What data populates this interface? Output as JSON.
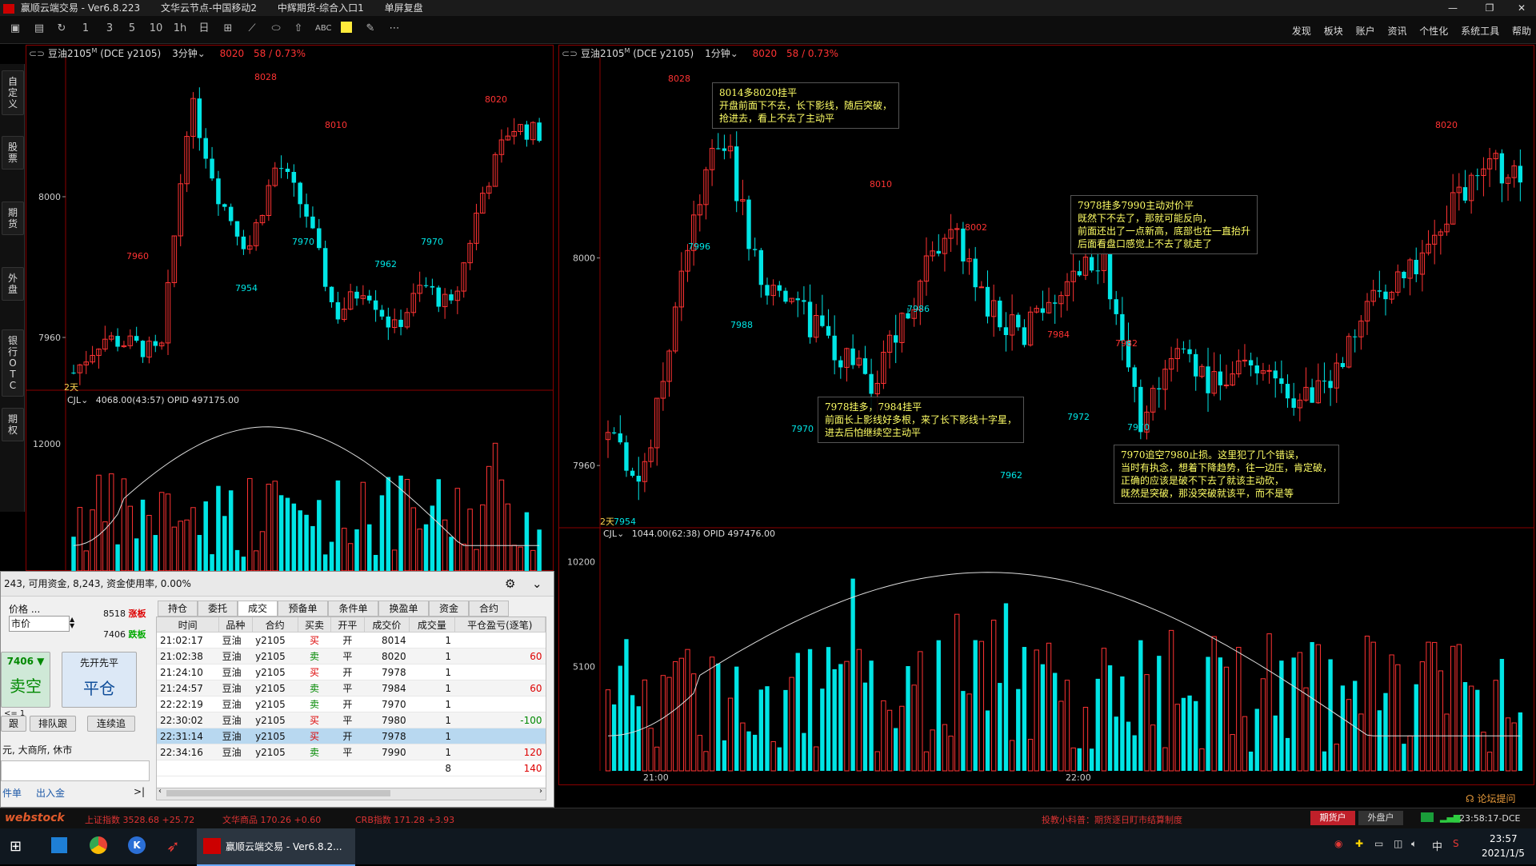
{
  "window": {
    "app_title": "赢顺云端交易 - Ver6.8.223",
    "connection1": "文华云节点-中国移动2",
    "connection2": "中辉期货-综合入口1",
    "mode": "单屏复盘"
  },
  "menu": [
    "发现",
    "板块",
    "账户",
    "资讯",
    "个性化",
    "系统工具",
    "帮助"
  ],
  "sidenav": [
    "自定义",
    "股票",
    "期货",
    "外盘",
    "银行OTC",
    "期权"
  ],
  "left_chart": {
    "symbol": "豆油2105",
    "symbol_sup": "M",
    "exchange": "(DCE y2105)",
    "period": "3分钟",
    "price": "8020",
    "change": "58 / 0.73%",
    "indicator_label": "CJL",
    "indicator_values": "4068.00(43:57)  OPID 497175.00",
    "days_marker": "2天"
  },
  "right_chart": {
    "symbol": "豆油2105",
    "symbol_sup": "M",
    "exchange": "(DCE y2105)",
    "period": "1分钟",
    "price": "8020",
    "change": "58 / 0.73%",
    "indicator_label": "CJL",
    "indicator_values": "1044.00(62:38)  OPID 497476.00",
    "days_marker": "2天",
    "time_labels": [
      "21:00",
      "22:00"
    ],
    "annotations": [
      "8014多8020挂平\n开盘前面下不去，长下影线，随后突破，\n抢进去，看上不去了主动平",
      "7978挂多7990主动对价平\n既然下不去了，那就可能反向，\n前面还出了一点新高，底部也在一直抬升\n后面看盘口感觉上不去了就走了",
      "7978挂多，7984挂平\n前面长上影线好多根，来了长下影线十字星，\n进去后怕继续空主动平",
      "7970追空7980止损。这里犯了几个错误，\n当时有执念，想着下降趋势，往一边压，肯定破，\n正确的应该是破不下去了就该主动砍，\n既然是突破，那没突破就该平，而不是等"
    ]
  },
  "chart_data": [
    {
      "type": "candlestick",
      "title": "豆油2105 3分钟",
      "y_ticks": [
        7960,
        8000
      ],
      "volume_ticks": [
        12000
      ],
      "price_labels": [
        "8028",
        "8010",
        "8020",
        "7960",
        "7954",
        "7970",
        "7962",
        "7970"
      ]
    },
    {
      "type": "candlestick",
      "title": "豆油2105 1分钟",
      "y_ticks": [
        7960,
        8000
      ],
      "volume_ticks": [
        5100,
        10200
      ],
      "x_ticks": [
        "21:00",
        "22:00"
      ],
      "price_labels": [
        "8028",
        "7996",
        "7988",
        "7970",
        "8010",
        "7986",
        "8002",
        "7962",
        "7984",
        "7972",
        "7982",
        "7970",
        "8020",
        "7954"
      ]
    }
  ],
  "trade_panel": {
    "header": "243, 可用资金, 8,243, 资金使用率, 0.00%",
    "price_label": "价格 ...",
    "price_value": "市价",
    "limit_up_value": "8518",
    "limit_up_label": "涨板",
    "limit_down_value": "7406",
    "limit_down_label": "跌板",
    "qty_price": "7406",
    "sell_button": "卖空",
    "flat_label": "先开先平",
    "flat_button": "平仓",
    "qty_hint": "<= 1",
    "follow1": "跟",
    "follow2": "排队跟",
    "follow3": "连续追",
    "exchange_status": "元, 大商所, 休市",
    "link1": "件单",
    "link2": "出入金",
    "tabs": [
      "持仓",
      "委托",
      "成交",
      "预备单",
      "条件单",
      "换盈单",
      "资金",
      "合约"
    ],
    "active_tab": "成交",
    "columns": [
      "时间",
      "品种",
      "合约",
      "买卖",
      "开平",
      "成交价",
      "成交量",
      "平仓盈亏(逐笔)"
    ],
    "rows": [
      {
        "time": "21:02:17",
        "name": "豆油",
        "contract": "y2105",
        "side": "买",
        "oc": "开",
        "price": "8014",
        "qty": "1",
        "pnl": ""
      },
      {
        "time": "21:02:38",
        "name": "豆油",
        "contract": "y2105",
        "side": "卖",
        "oc": "平",
        "price": "8020",
        "qty": "1",
        "pnl": "60"
      },
      {
        "time": "21:24:10",
        "name": "豆油",
        "contract": "y2105",
        "side": "买",
        "oc": "开",
        "price": "7978",
        "qty": "1",
        "pnl": ""
      },
      {
        "time": "21:24:57",
        "name": "豆油",
        "contract": "y2105",
        "side": "卖",
        "oc": "平",
        "price": "7984",
        "qty": "1",
        "pnl": "60"
      },
      {
        "time": "22:22:19",
        "name": "豆油",
        "contract": "y2105",
        "side": "卖",
        "oc": "开",
        "price": "7970",
        "qty": "1",
        "pnl": ""
      },
      {
        "time": "22:30:02",
        "name": "豆油",
        "contract": "y2105",
        "side": "买",
        "oc": "平",
        "price": "7980",
        "qty": "1",
        "pnl": "-100"
      },
      {
        "time": "22:31:14",
        "name": "豆油",
        "contract": "y2105",
        "side": "买",
        "oc": "开",
        "price": "7978",
        "qty": "1",
        "pnl": ""
      },
      {
        "time": "22:34:16",
        "name": "豆油",
        "contract": "y2105",
        "side": "卖",
        "oc": "平",
        "price": "7990",
        "qty": "1",
        "pnl": "120"
      }
    ],
    "total_qty": "8",
    "total_pnl": "140"
  },
  "statusbar": {
    "brand": "webstock",
    "idx1_name": "上证指数",
    "idx1_val": "3528.68 +25.72",
    "idx2_name": "文华商品",
    "idx2_val": "170.26 +0.60",
    "idx3_name": "CRB指数",
    "idx3_val": "171.28 +3.93",
    "tip": "投教小科普：期货逐日盯市结算制度",
    "forum": "论坛提问",
    "btn_futures": "期货户",
    "btn_foreign": "外盘户",
    "clock": "23:58:17-DCE"
  },
  "taskbar": {
    "app_label": "赢顺云端交易 - Ver6.8.2...",
    "ime": "中",
    "time": "23:57",
    "date": "2021/1/5"
  },
  "colors": {
    "up": "#ff3333",
    "down": "#00e5e5",
    "accent": "#8b0000"
  }
}
